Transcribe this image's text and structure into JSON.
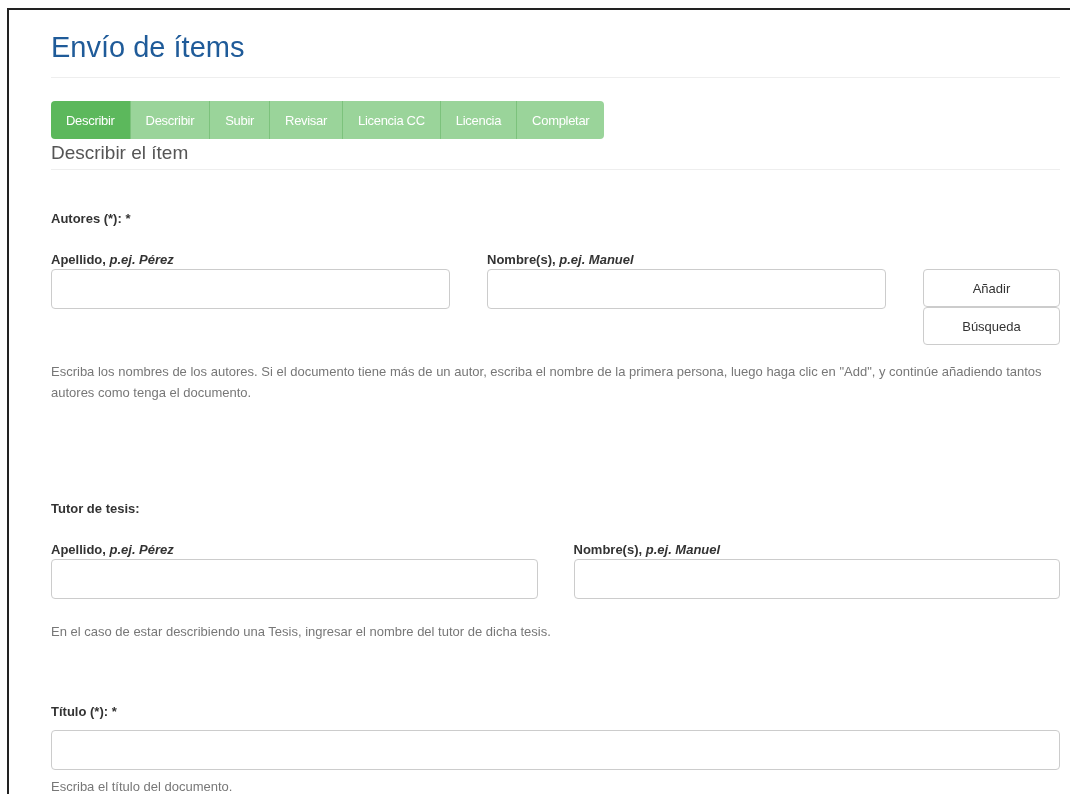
{
  "page_title": "Envío de ítems",
  "steps": [
    {
      "label": "Describir",
      "selected": true
    },
    {
      "label": "Describir",
      "selected": false
    },
    {
      "label": "Subir",
      "selected": false
    },
    {
      "label": "Revisar",
      "selected": false
    },
    {
      "label": "Licencia CC",
      "selected": false
    },
    {
      "label": "Licencia",
      "selected": false
    },
    {
      "label": "Completar",
      "selected": false
    }
  ],
  "section_title": "Describir el ítem",
  "authors": {
    "label": "Autores (*): *",
    "fields": [
      {
        "label": "Apellido,",
        "example": "p.ej. Pérez"
      },
      {
        "label": "Nombre(s),",
        "example": "p.ej. Manuel"
      }
    ],
    "buttons": [
      "Añadir",
      "Búsqueda"
    ],
    "help": "Escriba los nombres de los autores. Si el documento tiene más de un autor, escriba el nombre de la primera persona, luego haga clic en \"Add\", y continúe añadiendo tantos autores como tenga el documento."
  },
  "advisor": {
    "label": "Tutor de tesis:",
    "fields": [
      {
        "label": "Apellido,",
        "example": "p.ej. Pérez"
      },
      {
        "label": "Nombre(s),",
        "example": "p.ej. Manuel"
      }
    ],
    "help": "En el caso de estar describiendo una Tesis, ingresar el nombre del tutor de dicha tesis."
  },
  "title_field": {
    "label": "Título (*): *",
    "help": "Escriba el título del documento."
  }
}
